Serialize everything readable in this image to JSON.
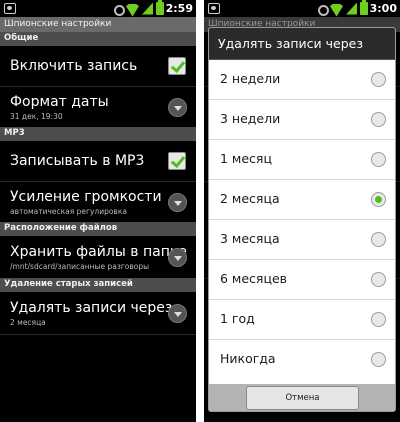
{
  "left": {
    "status_time": "2:59",
    "title": "Шпионские настройки",
    "sections": {
      "general": "Общие",
      "mp3": "MP3",
      "location": "Расположение файлов",
      "delete_old": "Удаление старых записей"
    },
    "items": {
      "enable_record": {
        "title": "Включить запись"
      },
      "date_format": {
        "title": "Формат даты",
        "summary": "31 дек, 19:30"
      },
      "record_mp3": {
        "title": "Записывать в MP3"
      },
      "volume_boost": {
        "title": "Усиление громкости",
        "summary": "автоматическая регулировка"
      },
      "store_folder": {
        "title": "Хранить файлы в папке",
        "summary": "/mnt/sdcard/записанные разговоры"
      },
      "delete_after": {
        "title": "Удалять записи через",
        "summary": "2 месяца"
      }
    },
    "checkbox_checked_color": "#4cc11a"
  },
  "right": {
    "status_time": "3:00",
    "title": "Шпионские настройки",
    "dialog": {
      "title": "Удалять записи через",
      "options": [
        "2 недели",
        "3 недели",
        "1 месяц",
        "2 месяца",
        "3 месяца",
        "6 месяцев",
        "1 год",
        "Никогда"
      ],
      "selected": "2 месяца",
      "cancel_label": "Отмена"
    }
  }
}
